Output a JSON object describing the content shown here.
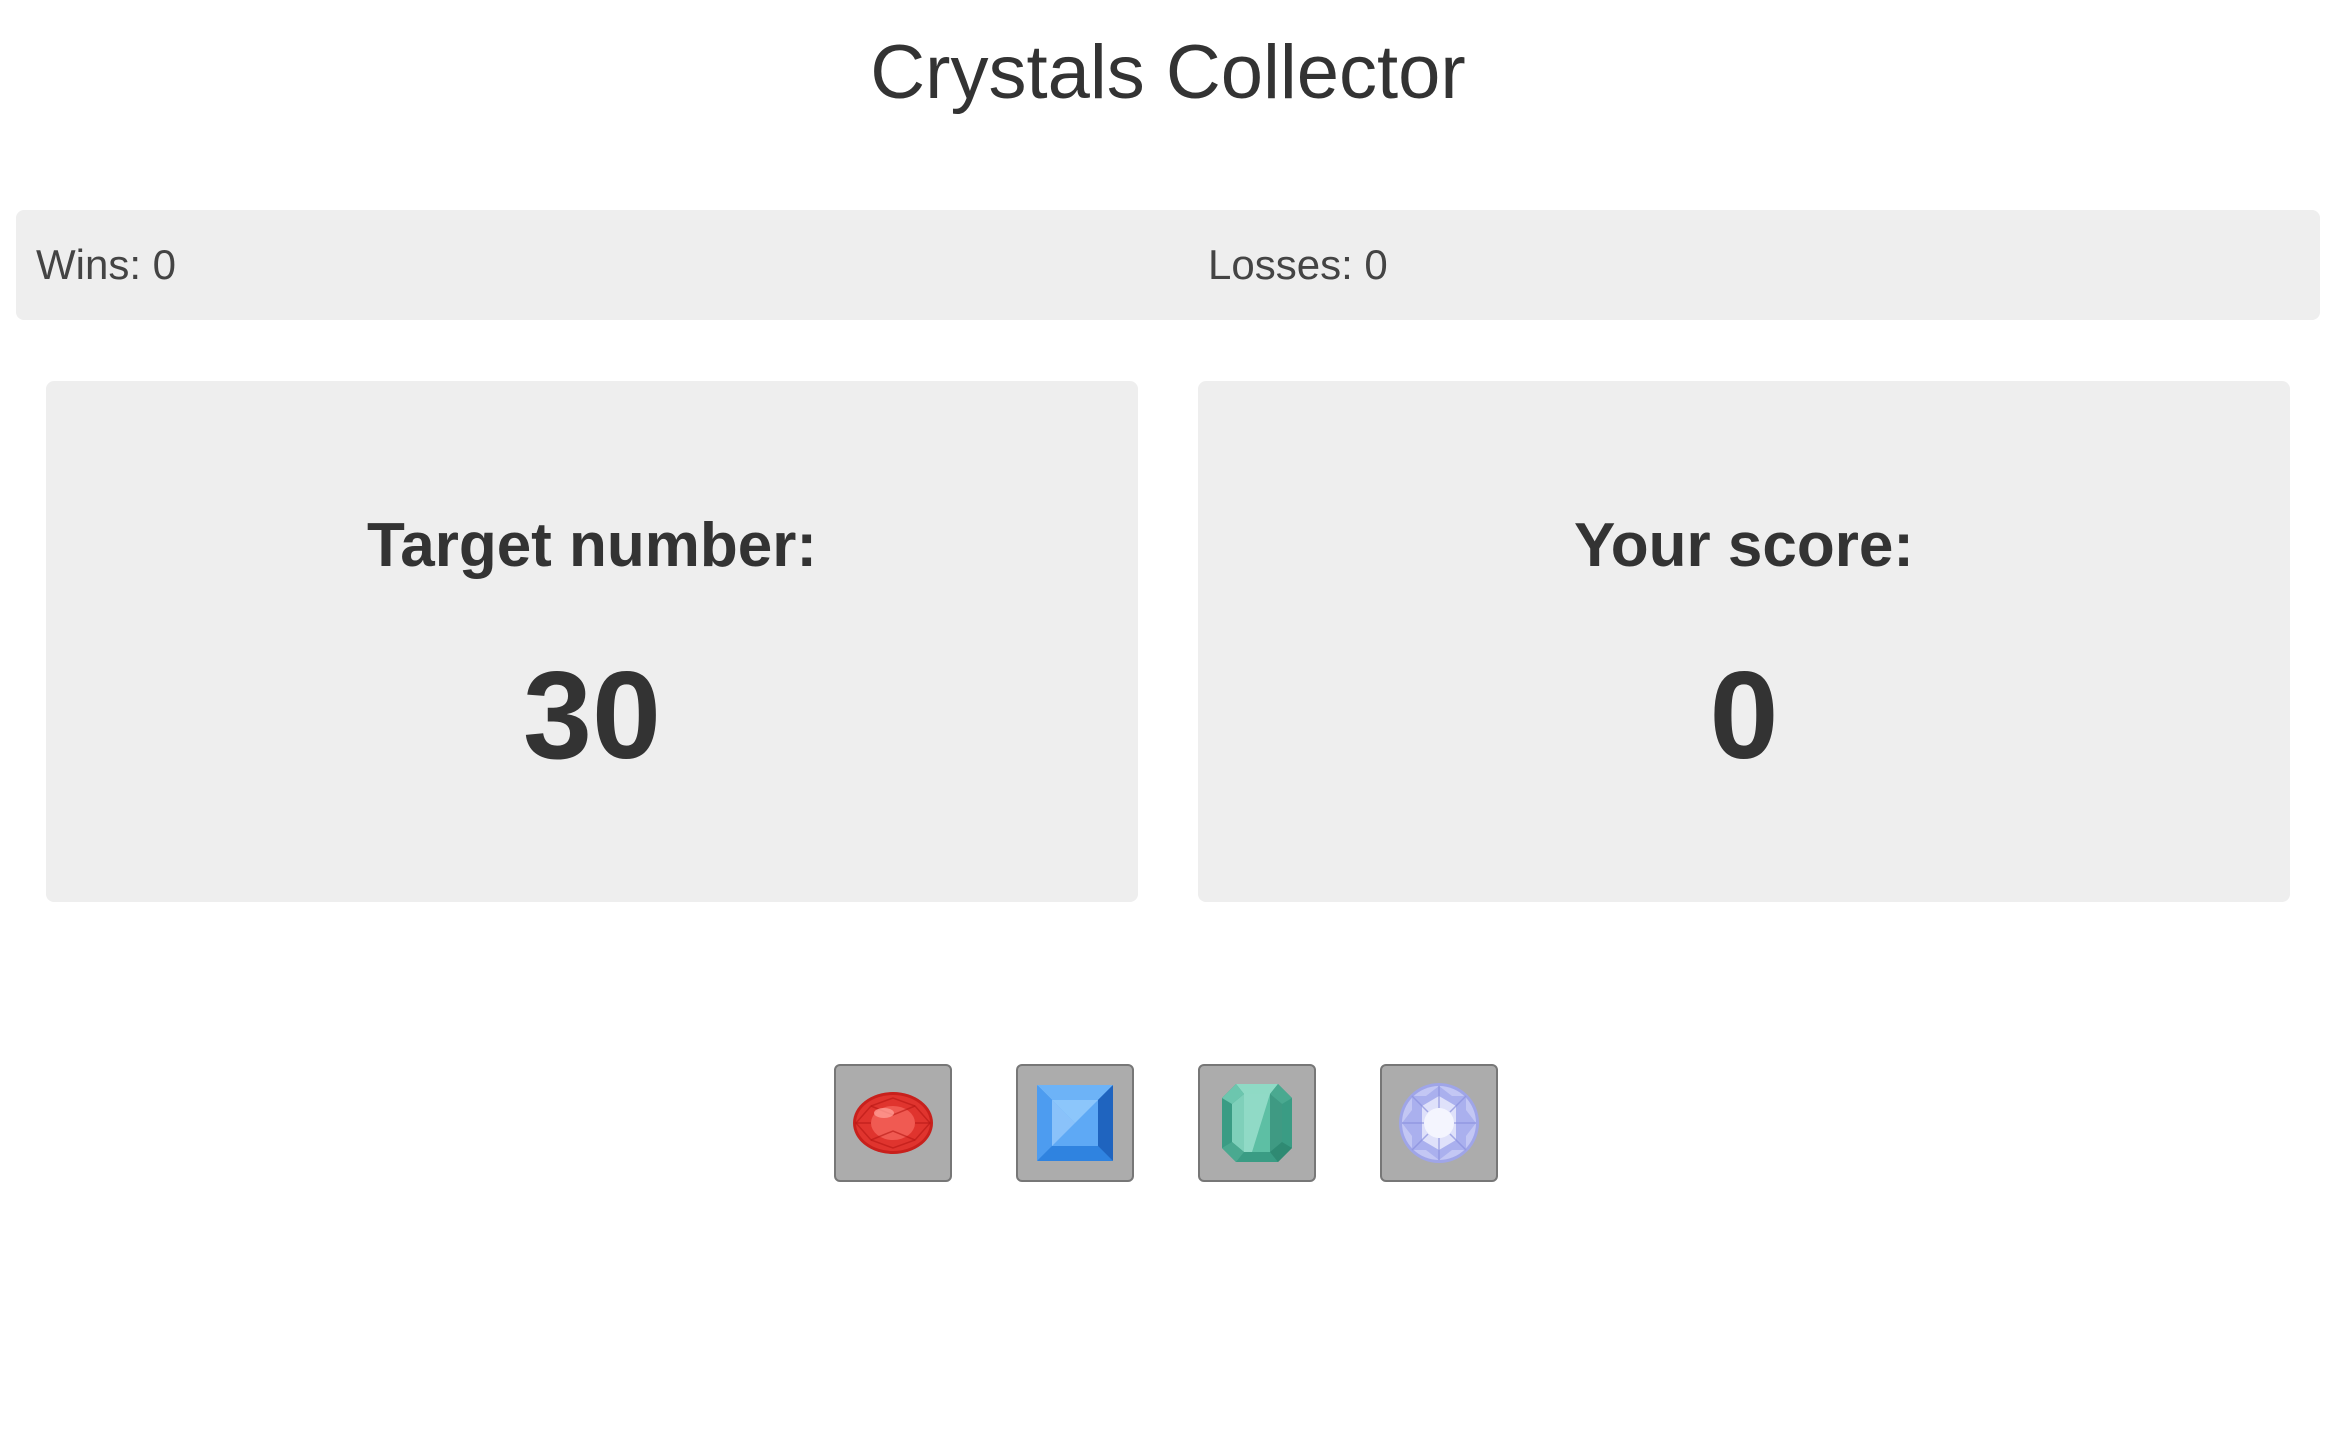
{
  "title": "Crystals Collector",
  "stats": {
    "wins_label": "Wins: 0",
    "losses_label": "Losses: 0"
  },
  "target": {
    "label": "Target number:",
    "value": "30"
  },
  "score": {
    "label": "Your score:",
    "value": "0"
  },
  "crystals": [
    {
      "name": "red-crystal",
      "icon": "red-oval-gem-icon",
      "color": "#e0342e"
    },
    {
      "name": "blue-crystal",
      "icon": "blue-square-gem-icon",
      "color": "#3b8ee8"
    },
    {
      "name": "green-crystal",
      "icon": "green-emerald-gem-icon",
      "color": "#4fb49a"
    },
    {
      "name": "white-crystal",
      "icon": "clear-round-diamond-icon",
      "color": "#b9bdf0"
    }
  ],
  "colors": {
    "panel_background": "#eeeeee",
    "crystal_button_background": "#acacac",
    "text": "#333333"
  }
}
